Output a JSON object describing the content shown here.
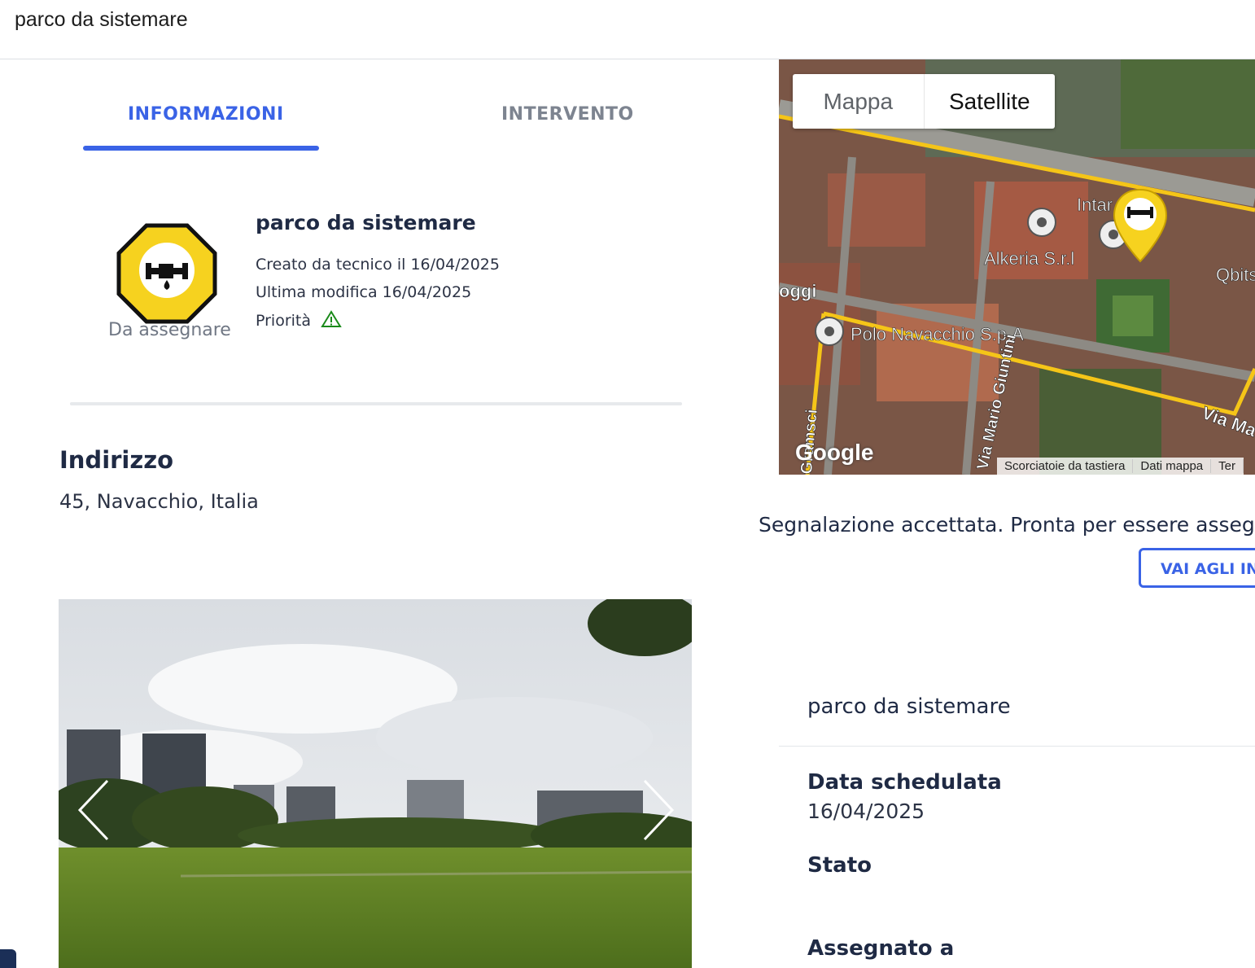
{
  "header": {
    "title": "parco da sistemare"
  },
  "tabs": [
    {
      "label": "INFORMAZIONI",
      "active": true
    },
    {
      "label": "INTERVENTO",
      "active": false
    }
  ],
  "report": {
    "status_label": "Da assegnare",
    "status_icon": "leaking-pipe-icon",
    "title": "parco da sistemare",
    "created": "Creato da tecnico il 16/04/2025",
    "modified": "Ultima modifica 16/04/2025",
    "priority_label": "Priorità",
    "priority_icon": "warning-triangle-icon"
  },
  "address": {
    "heading": "Indirizzo",
    "value": "45, Navacchio, Italia"
  },
  "map": {
    "type_options": [
      "Mappa",
      "Satellite"
    ],
    "selected": "Satellite",
    "labels": [
      "Intar",
      "Alkeria S.r.l",
      "Qbits",
      "oggi",
      "Polo Navacchio S.p.A",
      "Via Mario Giuntini",
      "Via Ma",
      "Gramsci"
    ],
    "logo": "Google",
    "footer": [
      "Scorciatoie da tastiera",
      "Dati mappa",
      "Ter"
    ]
  },
  "status_message": "Segnalazione accettata. Pronta per essere assegnata",
  "action_button": "VAI AGLI INTERVENTI",
  "details": {
    "title": "parco da sistemare",
    "date_label": "Data schedulata",
    "date_value": "16/04/2025",
    "state_label": "Stato",
    "assigned_label": "Assegnato a"
  },
  "colors": {
    "accent": "#3a63e6",
    "status_yellow": "#f6d21f",
    "route": "#f5c518"
  }
}
